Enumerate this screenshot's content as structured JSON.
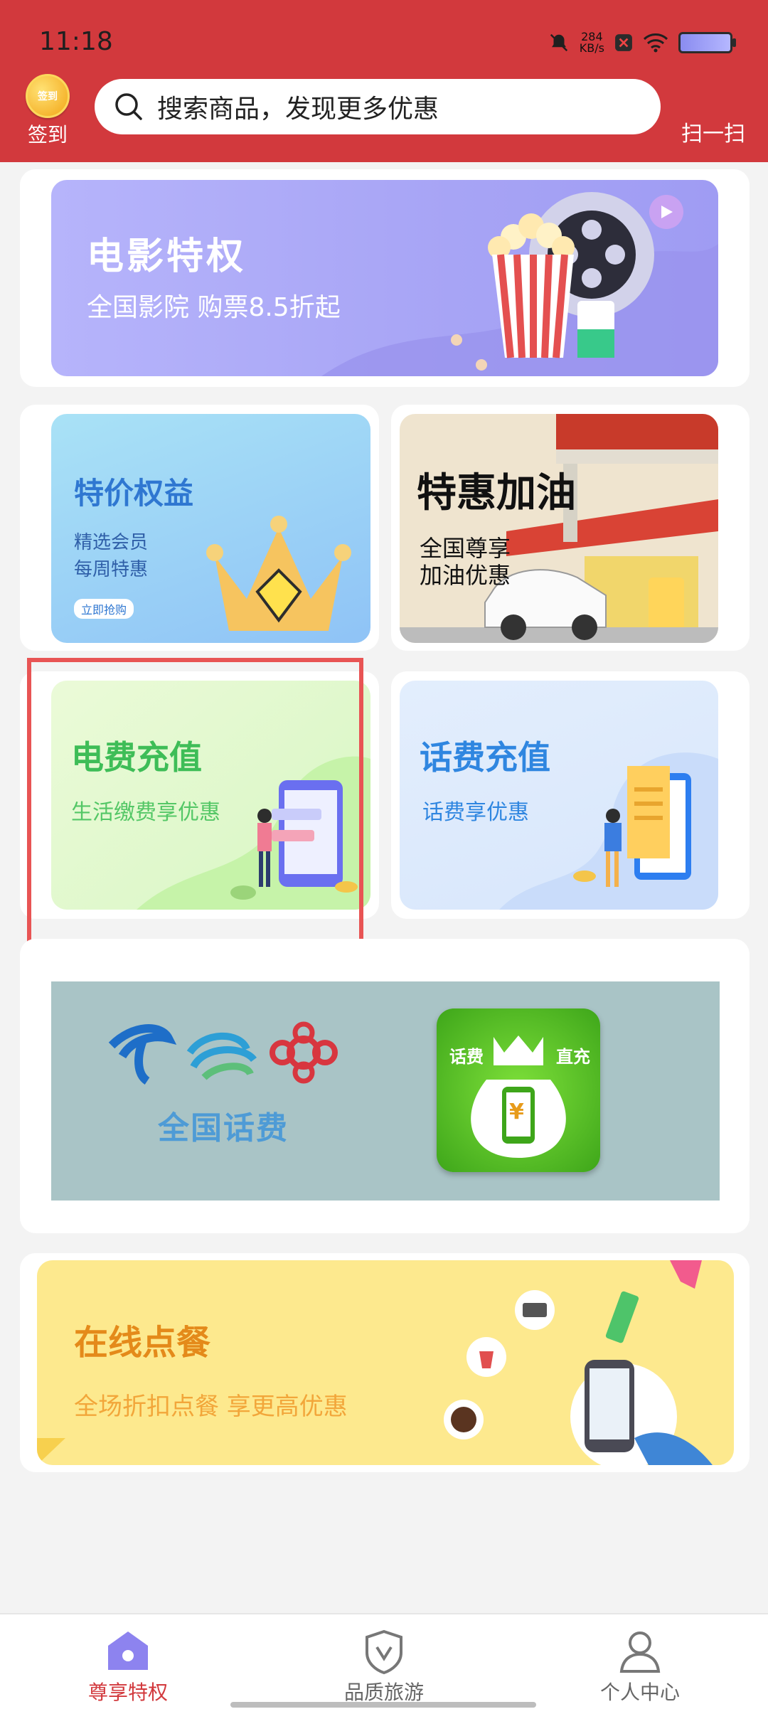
{
  "status_bar": {
    "time": "11:18",
    "net_speed_value": "284",
    "net_speed_unit": "KB/s"
  },
  "header": {
    "coin_text": "签到",
    "signin_label": "签到",
    "search_placeholder": "搜索商品，发现更多优惠",
    "scan_label": "扫一扫"
  },
  "banners": {
    "movie": {
      "title": "电影特权",
      "subtitle": "全国影院  购票8.5折起"
    },
    "special": {
      "title": "特价权益",
      "line1": "精选会员",
      "line2": "每周特惠",
      "button": "立即抢购"
    },
    "fuel": {
      "title": "特惠加油",
      "line1": "全国尊享",
      "line2": "加油优惠"
    },
    "electric": {
      "title": "电费充值",
      "subtitle": "生活缴费享优惠"
    },
    "phone": {
      "title": "话费充值",
      "subtitle": "话费享优惠"
    },
    "national": {
      "title": "全国话费",
      "bag_left": "话费",
      "bag_right": "直充",
      "yuan": "¥"
    },
    "food": {
      "title": "在线点餐",
      "subtitle": "全场折扣点餐 享更高优惠"
    }
  },
  "bottom_nav": {
    "tab1": "尊享特权",
    "tab2": "品质旅游",
    "tab3": "个人中心"
  },
  "colors": {
    "brand_red": "#d2393d"
  }
}
